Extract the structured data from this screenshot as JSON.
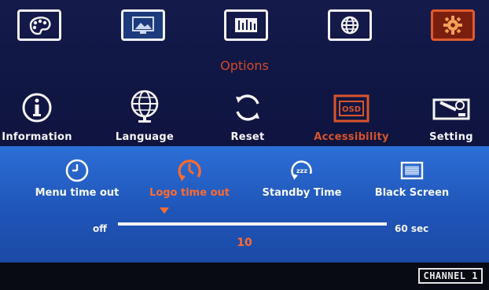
{
  "top_menu": [
    "color-palette-icon",
    "image-icon",
    "adjustment-icon",
    "globe-icon",
    "gear-icon"
  ],
  "menu_title": "Options",
  "options": [
    {
      "label": "Information",
      "icon": "info-icon"
    },
    {
      "label": "Language",
      "icon": "globe-icon"
    },
    {
      "label": "Reset",
      "icon": "reset-icon"
    },
    {
      "label": "Accessibility",
      "icon": "osd-icon"
    },
    {
      "label": "Setting",
      "icon": "setting-icon"
    }
  ],
  "selected_option": "Accessibility",
  "sub_options": [
    {
      "label": "Menu time out",
      "icon": "clock-icon"
    },
    {
      "label": "Logo time out",
      "icon": "timer-icon"
    },
    {
      "label": "Standby Time",
      "icon": "sleep-icon"
    },
    {
      "label": "Black Screen",
      "icon": "monitor-icon"
    }
  ],
  "selected_sub_option": "Logo time out",
  "slider": {
    "min_label": "off",
    "max_label": "60 sec",
    "value": "10",
    "fraction": 0.17
  },
  "channel_badge": "CHANNEL 1",
  "colors": {
    "highlight": "#ff6a2e",
    "panel": "#2c6fd6",
    "background": "#141a4a"
  }
}
